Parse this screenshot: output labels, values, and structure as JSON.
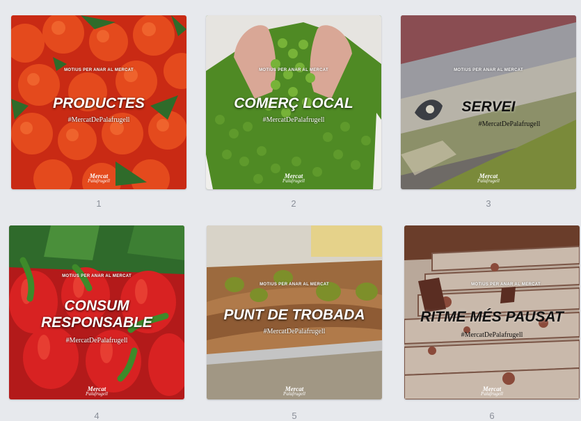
{
  "tagline": "MOTIUS PER ANAR AL MERCAT",
  "hashtag": "#MercatDePalafrugell",
  "logo": {
    "line1": "Mercat",
    "line2": "Palafrugell"
  },
  "colors": {
    "background": "#e7e9ed",
    "page_number": "#8a8f99",
    "title_light": "#ffffff",
    "title_dark": "#111111"
  },
  "cards": [
    {
      "number": "1",
      "title_lines": [
        "PRODUCTES"
      ],
      "image": "tomatoes"
    },
    {
      "number": "2",
      "title_lines": [
        "COMERÇ LOCAL"
      ],
      "image": "green-peas-in-hands"
    },
    {
      "number": "3",
      "title_lines": [
        "SERVEI"
      ],
      "image": "fish"
    },
    {
      "number": "4",
      "title_lines": [
        "CONSUM",
        "RESPONSABLE"
      ],
      "image": "red-peppers"
    },
    {
      "number": "5",
      "title_lines": [
        "PUNT DE TROBADA"
      ],
      "image": "tapas-with-olives"
    },
    {
      "number": "6",
      "title_lines": [
        "RITME MÉS PAUSAT"
      ],
      "image": "cured-sausages"
    }
  ]
}
